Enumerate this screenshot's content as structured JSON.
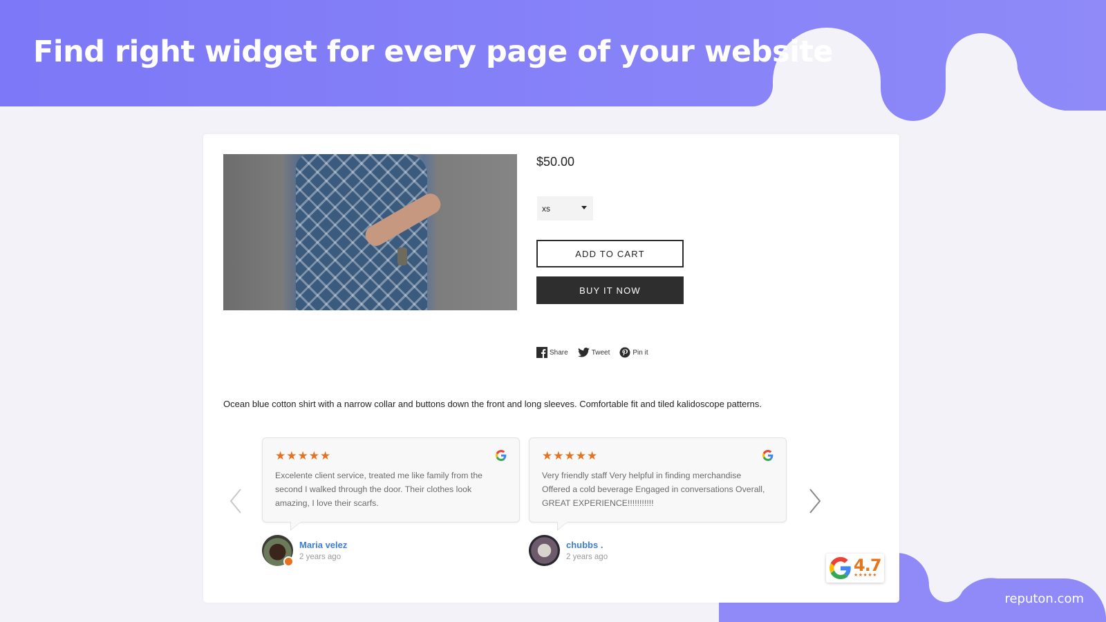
{
  "banner": {
    "headline": "Find right widget for every page of your website",
    "brand": "reputon.com",
    "accent_color": "#8b86f8",
    "background_color": "#f3f2f8"
  },
  "product": {
    "image_alt": "Man wearing ocean blue patterned shirt",
    "price": "$50.00",
    "size_select": {
      "selected": "xs",
      "icon": "caret-down-icon"
    },
    "add_to_cart_label": "ADD TO CART",
    "buy_now_label": "BUY IT NOW",
    "social": [
      {
        "icon": "facebook-icon",
        "label": "Share"
      },
      {
        "icon": "twitter-icon",
        "label": "Tweet"
      },
      {
        "icon": "pinterest-icon",
        "label": "Pin it"
      }
    ],
    "description": "Ocean blue cotton shirt with a narrow collar and buttons down the front and long sleeves. Comfortable fit and tiled kalidoscope patterns."
  },
  "reviews_widget": {
    "prev_icon": "chevron-left-icon",
    "next_icon": "chevron-right-icon",
    "star_color": "#e8711f",
    "reviews": [
      {
        "stars": "★★★★★",
        "rating": 5,
        "source_icon": "google-icon",
        "text": "Excelente client service, treated me like family from the second I walked through the door. Their clothes look amazing, I love their scarfs.",
        "author": "Maria velez",
        "time": "2 years ago"
      },
      {
        "stars": "★★★★★",
        "rating": 5,
        "source_icon": "google-icon",
        "text": "Very friendly staff Very helpful in finding merchandise Offered a cold beverage Engaged in conversations Overall, GREAT EXPERIENCE!!!!!!!!!!!",
        "author": "chubbs .",
        "time": "2 years ago"
      }
    ]
  },
  "rating_badge": {
    "source_icon": "google-icon",
    "score": "4.7",
    "stars": "★★★★★",
    "rating_value": 4.7
  }
}
